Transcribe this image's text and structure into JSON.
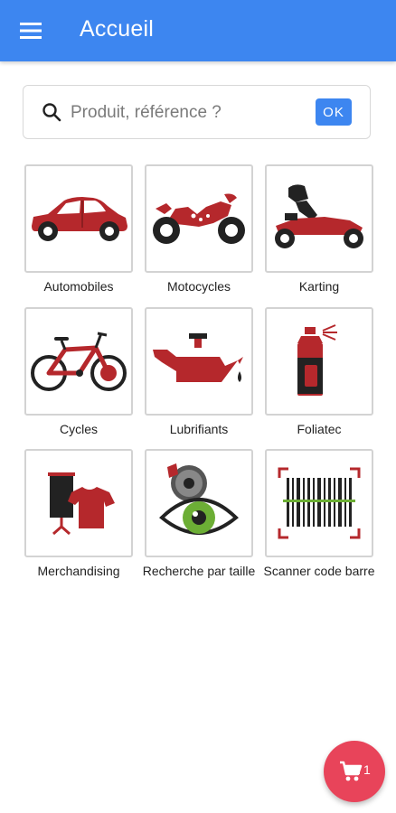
{
  "appbar": {
    "title": "Accueil",
    "color": "#3d86f0",
    "menu_icon": "hamburger-menu-icon"
  },
  "search": {
    "placeholder": "Produit, référence ?",
    "value": "",
    "button_label": "OK",
    "icon": "search-icon"
  },
  "categories": [
    {
      "label": "Automobiles",
      "icon": "car-icon"
    },
    {
      "label": "Motocycles",
      "icon": "motorcycle-icon"
    },
    {
      "label": "Karting",
      "icon": "kart-icon"
    },
    {
      "label": "Cycles",
      "icon": "bicycle-icon"
    },
    {
      "label": "Lubrifiants",
      "icon": "oil-can-icon"
    },
    {
      "label": "Foliatec",
      "icon": "spray-can-icon"
    },
    {
      "label": "Merchandising",
      "icon": "banner-tshirt-icon"
    },
    {
      "label": "Recherche par taille",
      "icon": "eye-search-icon"
    },
    {
      "label": "Scanner code barre",
      "icon": "barcode-icon"
    }
  ],
  "cart": {
    "count": "1",
    "icon": "cart-icon",
    "color": "#e8445a"
  },
  "theme": {
    "icon_red": "#b5282c",
    "icon_dark": "#222222",
    "eye_green": "#6cae35"
  }
}
